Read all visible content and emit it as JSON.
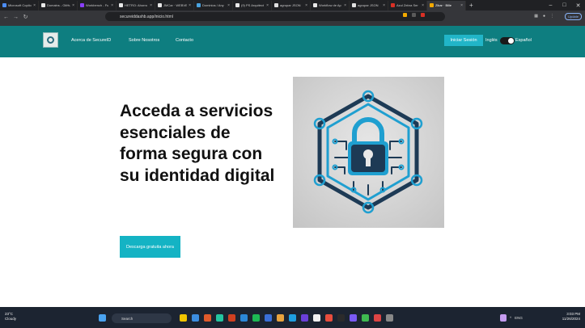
{
  "browser": {
    "tabs": [
      {
        "label": "Microsoft Copilo",
        "color": "#4c8df6"
      },
      {
        "label": "Domains - GitHu",
        "color": "#e8e8e8"
      },
      {
        "label": "Workbench - Fu",
        "color": "#8a3ffc"
      },
      {
        "label": "HETRO: Ahorro p",
        "color": "#e8e8e8"
      },
      {
        "label": "JMCar · WEBVE",
        "color": "#e8e8e8"
      },
      {
        "label": "Dominios / Any",
        "color": "#4aa3df"
      },
      {
        "label": "(9) PS Arquitect",
        "color": "#e8e8e8"
      },
      {
        "label": "agrupar JSON",
        "color": "#e0e0e0"
      },
      {
        "label": "Workflow de Ap",
        "color": "#e8e8e8"
      },
      {
        "label": "agrupar JSON",
        "color": "#e0e0e0"
      },
      {
        "label": "Azul Zebra Ser",
        "color": "#d93025"
      },
      {
        "label": "Zikar · Bille",
        "color": "#f2a900",
        "active": true
      }
    ],
    "url": "secureiddashb.app/inicio.html",
    "update_label": "Update"
  },
  "site": {
    "nav": {
      "links": [
        "Acerca de SecureID",
        "Sobre Nosotros",
        "Contacto"
      ],
      "login_label": "Iniciar Sesión",
      "lang_left": "Inglés",
      "lang_right": "Español"
    },
    "hero": {
      "headline": "Acceda a servicios esenciales de forma segura con su identidad digital",
      "cta_label": "Descarga gratuita ahora"
    }
  },
  "taskbar": {
    "weather_temp": "23°C",
    "weather_desc": "Cloudy",
    "search_placeholder": "Search",
    "lang": "ENG",
    "time": "3:03 PM",
    "date": "11/26/2024"
  },
  "colors": {
    "nav_bg": "#0e7e80",
    "accent": "#14b3c4"
  }
}
